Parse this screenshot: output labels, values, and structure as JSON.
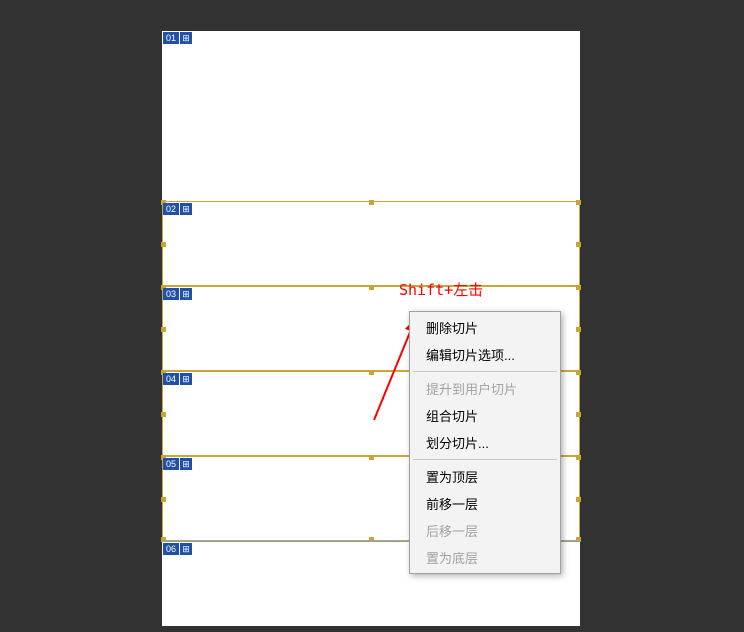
{
  "annotation": {
    "hint": "Shift+左击"
  },
  "slices": {
    "s01": "01",
    "s02": "02",
    "s03": "03",
    "s04": "04",
    "s05": "05",
    "s06": "06"
  },
  "menu": {
    "delete_slice": "删除切片",
    "edit_slice_options": "编辑切片选项...",
    "promote_user_slice": "提升到用户切片",
    "combine_slices": "组合切片",
    "divide_slice": "划分切片...",
    "bring_to_front": "置为顶层",
    "bring_forward": "前移一层",
    "send_backward": "后移一层",
    "send_to_back": "置为底层"
  }
}
